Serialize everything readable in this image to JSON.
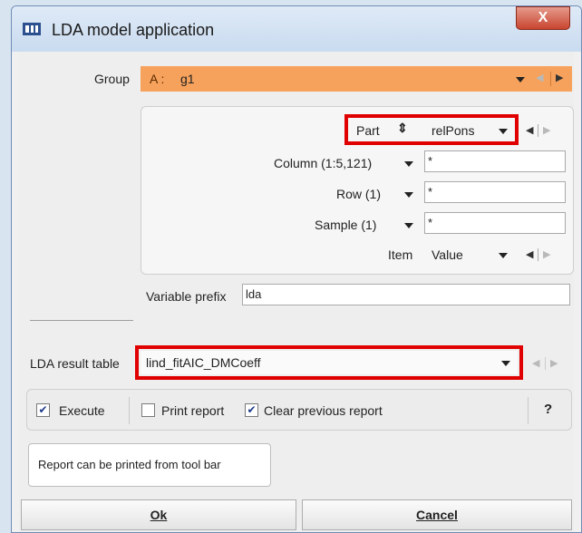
{
  "window": {
    "title": "LDA model application",
    "close_glyph": "X"
  },
  "group": {
    "label": "Group",
    "prefix": "A :",
    "value": "g1"
  },
  "part": {
    "label": "Part",
    "value": "relPons"
  },
  "fields": [
    {
      "label": "Column (1:5,121)",
      "value": "*"
    },
    {
      "label": "Row (1)",
      "value": "*"
    },
    {
      "label": "Sample (1)",
      "value": "*"
    }
  ],
  "item": {
    "label": "Item",
    "value": "Value"
  },
  "variable_prefix": {
    "label": "Variable prefix",
    "value": "lda"
  },
  "result_table": {
    "label": "LDA result table",
    "value": "lind_fitAIC_DMCoeff"
  },
  "options": {
    "execute": {
      "label": "Execute",
      "checked": true
    },
    "print_report": {
      "label": "Print report",
      "checked": false
    },
    "clear_report": {
      "label": "Clear previous report",
      "checked": true
    },
    "help": "?"
  },
  "tooltip": "Report can be printed from tool bar",
  "buttons": {
    "ok": "Ok",
    "cancel": "Cancel"
  },
  "colors": {
    "group_bar": "#f7a25c",
    "highlight": "#e00000",
    "title_bar": "#c9dbef"
  },
  "icons": [
    "app-icon",
    "close-icon",
    "chevron-down-icon",
    "arrow-left-icon",
    "arrow-right-icon",
    "sort-icon",
    "checkmark-icon"
  ]
}
